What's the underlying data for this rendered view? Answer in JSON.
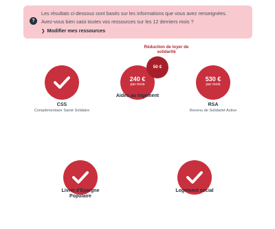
{
  "notice": {
    "line1": "Les résultats ci-dessous sont basés sur les informations que vous avez renseignées.",
    "line2": "Avez-vous bien saisi toutes vos ressources sur les 12 derniers mois ?",
    "modify_label": "Modifier mes ressources",
    "icon_glyph": "?",
    "arrow_glyph": "❯"
  },
  "benefits": {
    "css": {
      "title": "CSS",
      "subtitle": "Complémentaire Santé Solidaire"
    },
    "aides_logement": {
      "title": "Aides au logement",
      "amount": "240 €",
      "period": "par mois"
    },
    "reduction": {
      "title": "Réduction de loyer de solidarité",
      "amount": "50 €"
    },
    "rsa": {
      "title": "RSA",
      "subtitle": "Revenu de Solidarité Active",
      "amount": "530 €",
      "period": "par mois"
    },
    "livret": {
      "title": "Livret d'Epargne Populaire"
    },
    "logement_social": {
      "title": "Logement social"
    }
  },
  "colors": {
    "accent_red": "#c8303e",
    "dark_red": "#a81f2c",
    "notice_bg": "#f8c9cf"
  }
}
